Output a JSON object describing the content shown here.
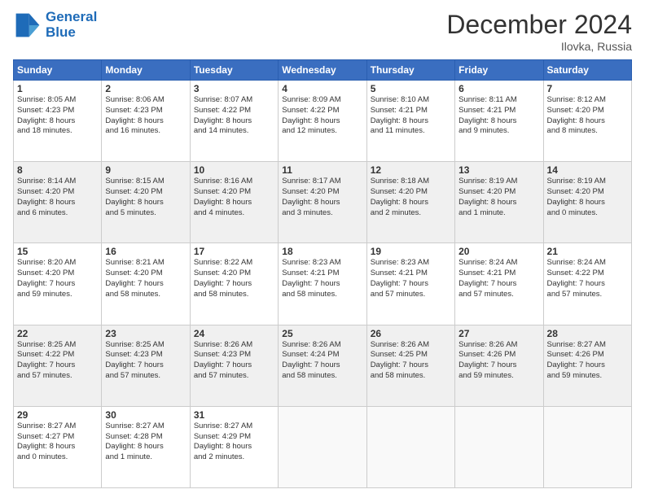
{
  "logo": {
    "line1": "General",
    "line2": "Blue"
  },
  "title": "December 2024",
  "location": "Ilovka, Russia",
  "days_header": [
    "Sunday",
    "Monday",
    "Tuesday",
    "Wednesday",
    "Thursday",
    "Friday",
    "Saturday"
  ],
  "weeks": [
    [
      {
        "day": "1",
        "info": "Sunrise: 8:05 AM\nSunset: 4:23 PM\nDaylight: 8 hours\nand 18 minutes."
      },
      {
        "day": "2",
        "info": "Sunrise: 8:06 AM\nSunset: 4:23 PM\nDaylight: 8 hours\nand 16 minutes."
      },
      {
        "day": "3",
        "info": "Sunrise: 8:07 AM\nSunset: 4:22 PM\nDaylight: 8 hours\nand 14 minutes."
      },
      {
        "day": "4",
        "info": "Sunrise: 8:09 AM\nSunset: 4:22 PM\nDaylight: 8 hours\nand 12 minutes."
      },
      {
        "day": "5",
        "info": "Sunrise: 8:10 AM\nSunset: 4:21 PM\nDaylight: 8 hours\nand 11 minutes."
      },
      {
        "day": "6",
        "info": "Sunrise: 8:11 AM\nSunset: 4:21 PM\nDaylight: 8 hours\nand 9 minutes."
      },
      {
        "day": "7",
        "info": "Sunrise: 8:12 AM\nSunset: 4:20 PM\nDaylight: 8 hours\nand 8 minutes."
      }
    ],
    [
      {
        "day": "8",
        "info": "Sunrise: 8:14 AM\nSunset: 4:20 PM\nDaylight: 8 hours\nand 6 minutes."
      },
      {
        "day": "9",
        "info": "Sunrise: 8:15 AM\nSunset: 4:20 PM\nDaylight: 8 hours\nand 5 minutes."
      },
      {
        "day": "10",
        "info": "Sunrise: 8:16 AM\nSunset: 4:20 PM\nDaylight: 8 hours\nand 4 minutes."
      },
      {
        "day": "11",
        "info": "Sunrise: 8:17 AM\nSunset: 4:20 PM\nDaylight: 8 hours\nand 3 minutes."
      },
      {
        "day": "12",
        "info": "Sunrise: 8:18 AM\nSunset: 4:20 PM\nDaylight: 8 hours\nand 2 minutes."
      },
      {
        "day": "13",
        "info": "Sunrise: 8:19 AM\nSunset: 4:20 PM\nDaylight: 8 hours\nand 1 minute."
      },
      {
        "day": "14",
        "info": "Sunrise: 8:19 AM\nSunset: 4:20 PM\nDaylight: 8 hours\nand 0 minutes."
      }
    ],
    [
      {
        "day": "15",
        "info": "Sunrise: 8:20 AM\nSunset: 4:20 PM\nDaylight: 7 hours\nand 59 minutes."
      },
      {
        "day": "16",
        "info": "Sunrise: 8:21 AM\nSunset: 4:20 PM\nDaylight: 7 hours\nand 58 minutes."
      },
      {
        "day": "17",
        "info": "Sunrise: 8:22 AM\nSunset: 4:20 PM\nDaylight: 7 hours\nand 58 minutes."
      },
      {
        "day": "18",
        "info": "Sunrise: 8:23 AM\nSunset: 4:21 PM\nDaylight: 7 hours\nand 58 minutes."
      },
      {
        "day": "19",
        "info": "Sunrise: 8:23 AM\nSunset: 4:21 PM\nDaylight: 7 hours\nand 57 minutes."
      },
      {
        "day": "20",
        "info": "Sunrise: 8:24 AM\nSunset: 4:21 PM\nDaylight: 7 hours\nand 57 minutes."
      },
      {
        "day": "21",
        "info": "Sunrise: 8:24 AM\nSunset: 4:22 PM\nDaylight: 7 hours\nand 57 minutes."
      }
    ],
    [
      {
        "day": "22",
        "info": "Sunrise: 8:25 AM\nSunset: 4:22 PM\nDaylight: 7 hours\nand 57 minutes."
      },
      {
        "day": "23",
        "info": "Sunrise: 8:25 AM\nSunset: 4:23 PM\nDaylight: 7 hours\nand 57 minutes."
      },
      {
        "day": "24",
        "info": "Sunrise: 8:26 AM\nSunset: 4:23 PM\nDaylight: 7 hours\nand 57 minutes."
      },
      {
        "day": "25",
        "info": "Sunrise: 8:26 AM\nSunset: 4:24 PM\nDaylight: 7 hours\nand 58 minutes."
      },
      {
        "day": "26",
        "info": "Sunrise: 8:26 AM\nSunset: 4:25 PM\nDaylight: 7 hours\nand 58 minutes."
      },
      {
        "day": "27",
        "info": "Sunrise: 8:26 AM\nSunset: 4:26 PM\nDaylight: 7 hours\nand 59 minutes."
      },
      {
        "day": "28",
        "info": "Sunrise: 8:27 AM\nSunset: 4:26 PM\nDaylight: 7 hours\nand 59 minutes."
      }
    ],
    [
      {
        "day": "29",
        "info": "Sunrise: 8:27 AM\nSunset: 4:27 PM\nDaylight: 8 hours\nand 0 minutes."
      },
      {
        "day": "30",
        "info": "Sunrise: 8:27 AM\nSunset: 4:28 PM\nDaylight: 8 hours\nand 1 minute."
      },
      {
        "day": "31",
        "info": "Sunrise: 8:27 AM\nSunset: 4:29 PM\nDaylight: 8 hours\nand 2 minutes."
      },
      null,
      null,
      null,
      null
    ]
  ]
}
